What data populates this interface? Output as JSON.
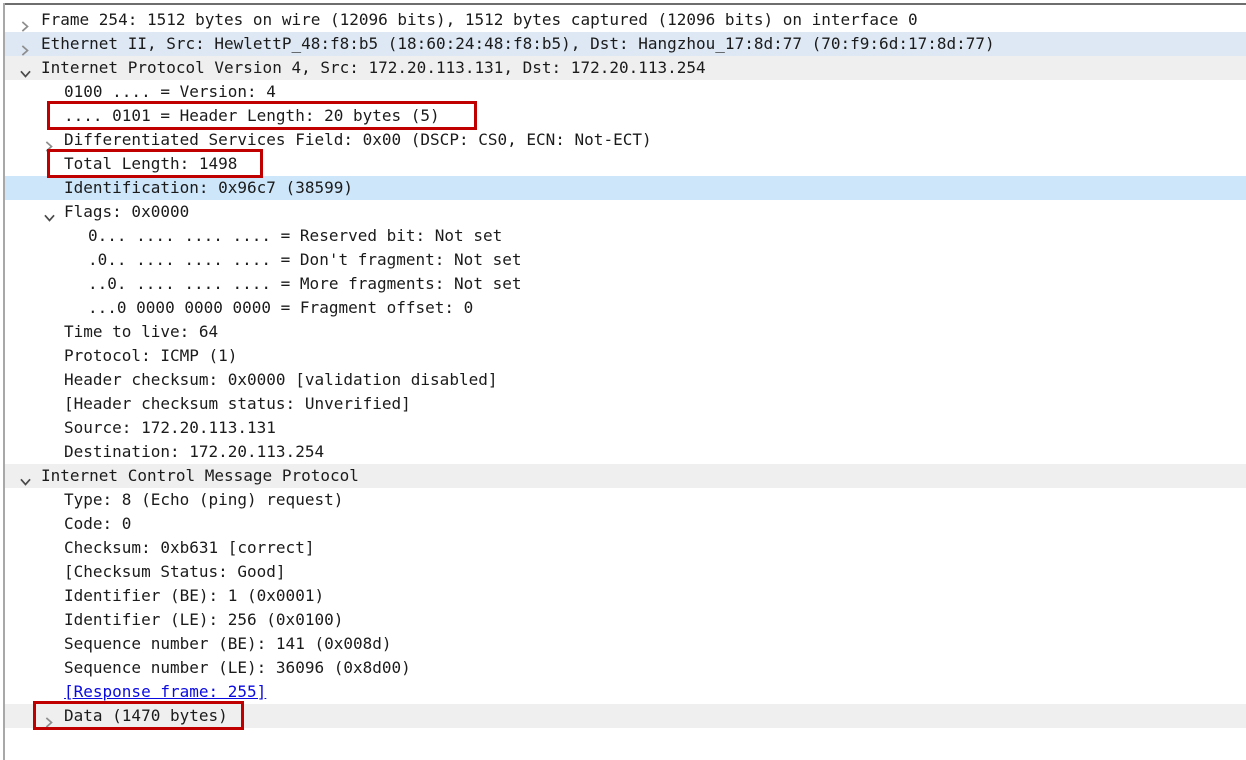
{
  "colors": {
    "annotation_red": "#c00000",
    "link_blue": "#0b0be0",
    "row_gray": "#efefef",
    "row_ethernet_blue": "#dde8f4",
    "row_selected_blue": "#cde6fa",
    "pane_border_top": "#6e6e6e",
    "pane_border_left": "#a8a8a8",
    "text": "#1b1b1b"
  },
  "icons": {
    "collapsed": "chevron-right",
    "expanded": "chevron-down"
  },
  "tree": {
    "rows": [
      {
        "label": "Frame 254: 1512 bytes on wire (12096 bits), 1512 bytes captured (12096 bits) on interface 0",
        "indent": 0,
        "arrow": "collapsed",
        "bg": "none",
        "redbox": false,
        "link": false
      },
      {
        "label": "Ethernet II, Src: HewlettP_48:f8:b5 (18:60:24:48:f8:b5), Dst: Hangzhou_17:8d:77 (70:f9:6d:17:8d:77)",
        "indent": 0,
        "arrow": "collapsed",
        "bg": "eth",
        "redbox": false,
        "link": false
      },
      {
        "label": "Internet Protocol Version 4, Src: 172.20.113.131, Dst: 172.20.113.254",
        "indent": 0,
        "arrow": "expanded",
        "bg": "gray",
        "redbox": false,
        "link": false
      },
      {
        "label": "0100 .... = Version: 4",
        "indent": 1,
        "arrow": null,
        "bg": "none",
        "redbox": false,
        "link": false
      },
      {
        "label": ".... 0101 = Header Length: 20 bytes (5)",
        "indent": 1,
        "arrow": null,
        "bg": "none",
        "redbox": true,
        "link": false
      },
      {
        "label": "Differentiated Services Field: 0x00 (DSCP: CS0, ECN: Not-ECT)",
        "indent": 1,
        "arrow": "collapsed",
        "bg": "none",
        "redbox": false,
        "link": false
      },
      {
        "label": "Total Length: 1498",
        "indent": 1,
        "arrow": null,
        "bg": "none",
        "redbox": true,
        "link": false
      },
      {
        "label": "Identification: 0x96c7 (38599)",
        "indent": 1,
        "arrow": null,
        "bg": "sel",
        "redbox": false,
        "link": false
      },
      {
        "label": "Flags: 0x0000",
        "indent": 1,
        "arrow": "expanded",
        "bg": "none",
        "redbox": false,
        "link": false
      },
      {
        "label": "0... .... .... .... = Reserved bit: Not set",
        "indent": 2,
        "arrow": null,
        "bg": "none",
        "redbox": false,
        "link": false
      },
      {
        "label": ".0.. .... .... .... = Don't fragment: Not set",
        "indent": 2,
        "arrow": null,
        "bg": "none",
        "redbox": false,
        "link": false
      },
      {
        "label": "..0. .... .... .... = More fragments: Not set",
        "indent": 2,
        "arrow": null,
        "bg": "none",
        "redbox": false,
        "link": false
      },
      {
        "label": "...0 0000 0000 0000 = Fragment offset: 0",
        "indent": 2,
        "arrow": null,
        "bg": "none",
        "redbox": false,
        "link": false
      },
      {
        "label": "Time to live: 64",
        "indent": 1,
        "arrow": null,
        "bg": "none",
        "redbox": false,
        "link": false
      },
      {
        "label": "Protocol: ICMP (1)",
        "indent": 1,
        "arrow": null,
        "bg": "none",
        "redbox": false,
        "link": false
      },
      {
        "label": "Header checksum: 0x0000 [validation disabled]",
        "indent": 1,
        "arrow": null,
        "bg": "none",
        "redbox": false,
        "link": false
      },
      {
        "label": "[Header checksum status: Unverified]",
        "indent": 1,
        "arrow": null,
        "bg": "none",
        "redbox": false,
        "link": false
      },
      {
        "label": "Source: 172.20.113.131",
        "indent": 1,
        "arrow": null,
        "bg": "none",
        "redbox": false,
        "link": false
      },
      {
        "label": "Destination: 172.20.113.254",
        "indent": 1,
        "arrow": null,
        "bg": "none",
        "redbox": false,
        "link": false
      },
      {
        "label": "Internet Control Message Protocol",
        "indent": 0,
        "arrow": "expanded",
        "bg": "gray",
        "redbox": false,
        "link": false
      },
      {
        "label": "Type: 8 (Echo (ping) request)",
        "indent": 1,
        "arrow": null,
        "bg": "none",
        "redbox": false,
        "link": false
      },
      {
        "label": "Code: 0",
        "indent": 1,
        "arrow": null,
        "bg": "none",
        "redbox": false,
        "link": false
      },
      {
        "label": "Checksum: 0xb631 [correct]",
        "indent": 1,
        "arrow": null,
        "bg": "none",
        "redbox": false,
        "link": false
      },
      {
        "label": "[Checksum Status: Good]",
        "indent": 1,
        "arrow": null,
        "bg": "none",
        "redbox": false,
        "link": false
      },
      {
        "label": "Identifier (BE): 1 (0x0001)",
        "indent": 1,
        "arrow": null,
        "bg": "none",
        "redbox": false,
        "link": false
      },
      {
        "label": "Identifier (LE): 256 (0x0100)",
        "indent": 1,
        "arrow": null,
        "bg": "none",
        "redbox": false,
        "link": false
      },
      {
        "label": "Sequence number (BE): 141 (0x008d)",
        "indent": 1,
        "arrow": null,
        "bg": "none",
        "redbox": false,
        "link": false
      },
      {
        "label": "Sequence number (LE): 36096 (0x8d00)",
        "indent": 1,
        "arrow": null,
        "bg": "none",
        "redbox": false,
        "link": false
      },
      {
        "label": "[Response frame: 255]",
        "indent": 1,
        "arrow": null,
        "bg": "none",
        "redbox": false,
        "link": true
      },
      {
        "label": "Data (1470 bytes)",
        "indent": 1,
        "arrow": "collapsed",
        "bg": "gray",
        "redbox": true,
        "link": false
      }
    ]
  }
}
